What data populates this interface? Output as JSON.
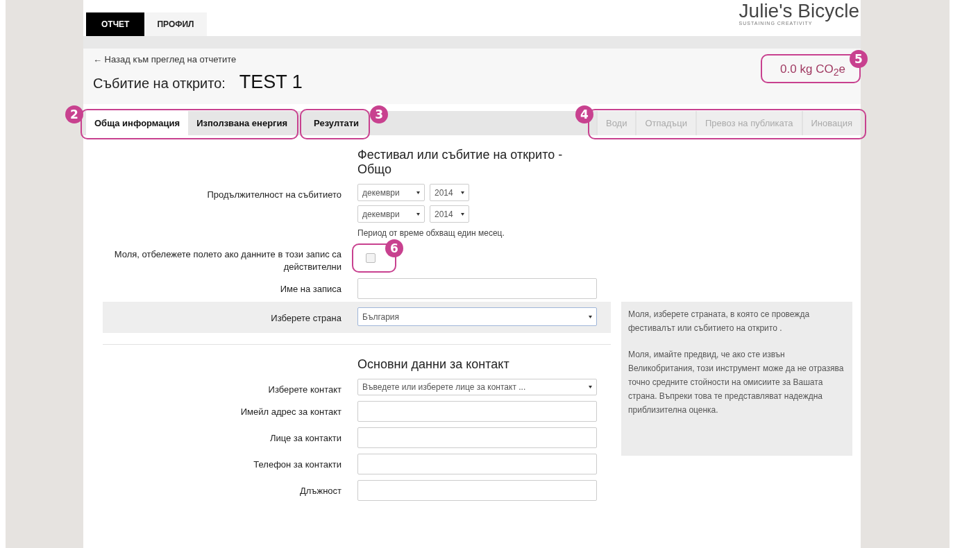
{
  "top_nav": {
    "tabs": [
      {
        "label": "ОТЧЕТ",
        "selected": true
      },
      {
        "label": "ПРОФИЛ",
        "selected": false
      }
    ]
  },
  "logo": {
    "name": "Julie's Bicycle",
    "tagline": "SUSTAINING CREATIVITY"
  },
  "header": {
    "back_link": "← Назад към преглед на отчетите",
    "title_label": "Събитие на открито:",
    "title_value": "TEST 1",
    "emissions": "0.0 kg CO$_{2}$e",
    "emissions_callout": "5"
  },
  "tab_groups": [
    {
      "callout": "2",
      "tabs": [
        {
          "label": "Обща информация",
          "selected": true,
          "disabled": false
        },
        {
          "label": "Използвана енергия",
          "selected": false,
          "disabled": false
        }
      ]
    },
    {
      "callout": "3",
      "tabs": [
        {
          "label": "Резултати",
          "selected": false,
          "disabled": false
        }
      ]
    },
    {
      "callout": "4",
      "tabs": [
        {
          "label": "Води",
          "selected": false,
          "disabled": true
        },
        {
          "label": "Отпадъци",
          "selected": false,
          "disabled": true
        },
        {
          "label": "Превоз на публиката",
          "selected": false,
          "disabled": true
        },
        {
          "label": "Иновация",
          "selected": false,
          "disabled": true
        }
      ]
    }
  ],
  "sections": [
    {
      "heading": "Фестивал или събитие на открито - Общо",
      "rows": [
        {
          "kind": "period",
          "label": "Продължителност на събитието",
          "periods": [
            {
              "month": "декември",
              "year": "2014"
            },
            {
              "month": "декември",
              "year": "2014"
            }
          ],
          "hint": "Период от време обхващ един месец."
        },
        {
          "kind": "checkbox",
          "label": "Моля, отбележете полето ако данните в този запис са действителни",
          "checked": false,
          "callout": "6"
        },
        {
          "kind": "text",
          "label": "Име на записа"
        },
        {
          "kind": "select",
          "label": "Изберете страна",
          "value": "България",
          "highlighted": true,
          "help": [
            "Моля, изберете страната, в която се провежда фестивалът или събитието на открито .",
            "Моля, имайте предвид, че ако сте извън Великобритания, този инструмент може да не отразява точно средните стойности на омисиите за Вашата страна. Въпреки това те представляват надеждна приблизителна оценка."
          ]
        }
      ]
    },
    {
      "heading": "Основни данни за контакт",
      "rows": [
        {
          "kind": "select",
          "label": "Изберете контакт",
          "placeholder": "Въведете или изберете лице за контакт ..."
        },
        {
          "kind": "text",
          "label": "Имейл адрес за контакт"
        },
        {
          "kind": "text",
          "label": "Лице за контакти"
        },
        {
          "kind": "text",
          "label": "Телефон за контакти"
        },
        {
          "kind": "text",
          "label": "Длъжност"
        }
      ]
    }
  ]
}
